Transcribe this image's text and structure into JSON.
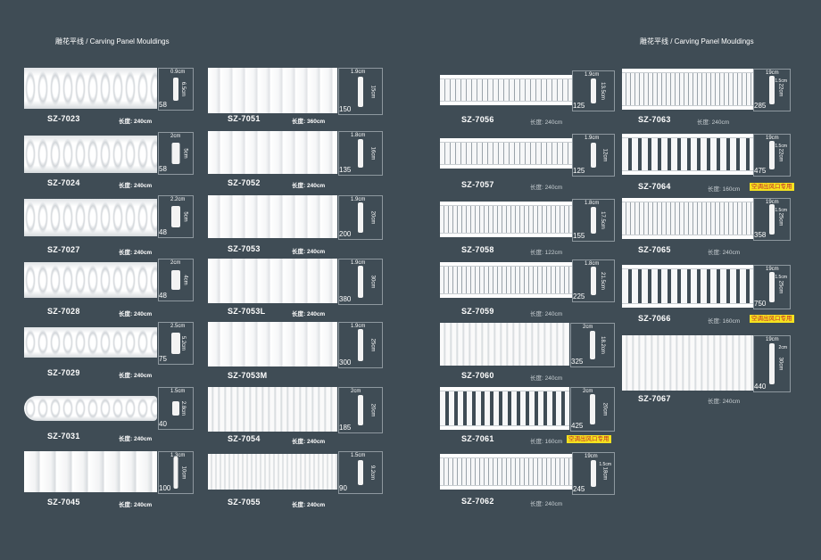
{
  "left_title": "雕花平线 / Carving Panel Mouldings",
  "right_title": "雕花平线 / Carving Panel Mouldings",
  "colors": {
    "background": "#3f4c55",
    "photo": "#f4f5f6",
    "note_bg": "#f4e21f",
    "note_text": "#c0282d"
  },
  "items": [
    {
      "code": "SZ-7023",
      "length": "长度: 240cm",
      "width": "0.9cm",
      "height": "6.5cm",
      "price": "58"
    },
    {
      "code": "SZ-7024",
      "length": "长度: 240cm",
      "width": "2cm",
      "height": "5cm",
      "price": "58"
    },
    {
      "code": "SZ-7027",
      "length": "长度: 240cm",
      "width": "2.2cm",
      "height": "5cm",
      "price": "48"
    },
    {
      "code": "SZ-7028",
      "length": "长度: 240cm",
      "width": "2cm",
      "height": "4cm",
      "price": "48"
    },
    {
      "code": "SZ-7029",
      "length": "长度: 240cm",
      "width": "2.5cm",
      "height": "5.2cm",
      "price": "75"
    },
    {
      "code": "SZ-7031",
      "length": "长度: 240cm",
      "width": "1.5cm",
      "height": "2.8cm",
      "price": "40"
    },
    {
      "code": "SZ-7045",
      "length": "长度: 240cm",
      "width": "1.3cm",
      "height": "10cm",
      "price": "100"
    },
    {
      "code": "SZ-7051",
      "length": "长度: 360cm",
      "width": "1.9cm",
      "height": "15cm",
      "price": "150"
    },
    {
      "code": "SZ-7052",
      "length": "长度: 240cm",
      "width": "1.8cm",
      "height": "16cm",
      "price": "135"
    },
    {
      "code": "SZ-7053",
      "length": "长度: 240cm",
      "width": "1.9cm",
      "height": "20cm",
      "price": "200"
    },
    {
      "code": "SZ-7053L",
      "length": "长度: 240cm",
      "width": "1.9cm",
      "height": "30cm",
      "price": "380"
    },
    {
      "code": "SZ-7053M",
      "length": "长度: 240cm",
      "width": "1.9cm",
      "height": "25cm",
      "price": "300"
    },
    {
      "code": "SZ-7054",
      "length": "长度: 240cm",
      "width": "2cm",
      "height": "20cm",
      "price": "185"
    },
    {
      "code": "SZ-7055",
      "length": "长度: 240cm",
      "width": "1.5cm",
      "height": "9.2cm",
      "price": "90"
    },
    {
      "code": "SZ-7056",
      "length": "长度: 240cm",
      "width": "1.9cm",
      "height": "13.5cm",
      "price": "125"
    },
    {
      "code": "SZ-7057",
      "length": "长度: 240cm",
      "width": "1.9cm",
      "height": "12cm",
      "price": "125"
    },
    {
      "code": "SZ-7058",
      "length": "长度: 122cm",
      "width": "1.8cm",
      "height": "17.5cm",
      "price": "155"
    },
    {
      "code": "SZ-7059",
      "length": "长度: 240cm",
      "width": "1.8cm",
      "height": "21.5cm",
      "price": "225"
    },
    {
      "code": "SZ-7060",
      "length": "长度: 240cm",
      "width": "2cm",
      "height": "18.2cm",
      "price": "325"
    },
    {
      "code": "SZ-7061",
      "length": "长度: 160cm",
      "width": "2cm",
      "height": "20cm",
      "price": "425",
      "note": "空调出风口专用"
    },
    {
      "code": "SZ-7062",
      "length": "长度: 240cm",
      "width": "19cm",
      "height": "18cm",
      "height2": "1.5cm",
      "price": "245"
    },
    {
      "code": "SZ-7063",
      "length": "长度: 240cm",
      "width": "19cm",
      "height": "22cm",
      "height2": "1.5cm",
      "price": "285"
    },
    {
      "code": "SZ-7064",
      "length": "长度: 160cm",
      "width": "19cm",
      "height": "22cm",
      "height2": "1.5cm",
      "price": "475",
      "note": "空调出风口专用"
    },
    {
      "code": "SZ-7065",
      "length": "长度: 240cm",
      "width": "19cm",
      "height": "25cm",
      "height2": "1.5cm",
      "price": "358"
    },
    {
      "code": "SZ-7066",
      "length": "长度: 160cm",
      "width": "19cm",
      "height": "25cm",
      "height2": "1.5cm",
      "price": "750",
      "note": "空调出风口专用"
    },
    {
      "code": "SZ-7067",
      "length": "长度: 240cm",
      "width": "19cm",
      "height": "30cm",
      "height2": "2cm",
      "price": "440"
    }
  ]
}
